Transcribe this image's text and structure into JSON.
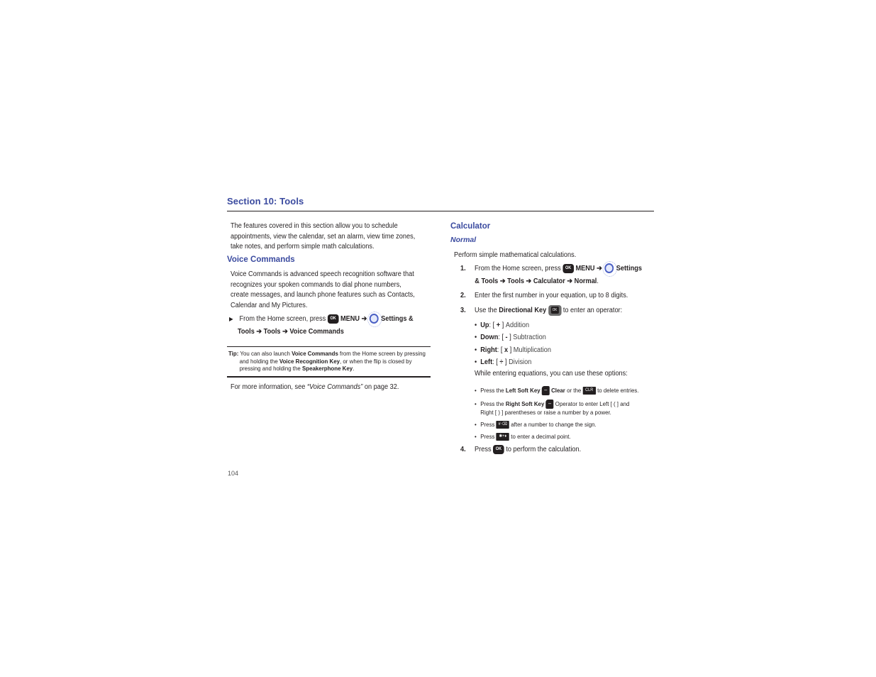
{
  "section_title": "Section 10: Tools",
  "intro": "The features covered in this section allow you to schedule appointments, view the calendar, set an alarm, view time zones, take notes, and perform simple math calculations.",
  "intro_lines": [
    "The features covered in this section allow you to schedule",
    "appointments, view the calendar, set an alarm, view time zones,",
    "take notes, and perform simple math calculations."
  ],
  "voice_commands": {
    "heading": "Voice Commands",
    "body_lines": [
      "Voice Commands is advanced speech recognition software that",
      "recognizes your spoken commands to dial phone numbers,",
      "create messages, and launch phone features such as Contacts,",
      "Calendar and My Pictures."
    ],
    "step": {
      "bullet": "▶",
      "prefix": "From the Home screen, press",
      "ok_key": "OK",
      "menu": "MENU",
      "arrow": "➔",
      "settings_line1": "Settings &",
      "settings_line2": "Tools",
      "tools": "Tools",
      "target": "Voice Commands"
    },
    "tip": {
      "label": "Tip:",
      "t1": "You can also launch",
      "b1": "Voice Commands",
      "t2": "from the Home screen by pressing",
      "t3": "and holding the",
      "b2": "Voice Recognition Key",
      "t4": ", or when the flip is closed by",
      "t5": "pressing and holding the",
      "b3": "Speakerphone Key",
      "t6": "."
    },
    "more_info": {
      "prefix": "For more information, see",
      "link": "“Voice Commands”",
      "suffix": "on page 32."
    }
  },
  "calculator": {
    "heading": "Calculator",
    "subheading": "Normal",
    "desc": "Perform simple mathematical calculations.",
    "steps": [
      {
        "num": "1.",
        "prefix": "From the Home screen, press",
        "ok_key": "OK",
        "menu": "MENU",
        "arrow": "➔",
        "settings": "Settings",
        "line2_a": "& Tools",
        "tools": "Tools",
        "calculator": "Calculator",
        "normal": "Normal",
        "period": "."
      },
      {
        "num": "2.",
        "text": "Enter the first number in your equation, up to 8 digits."
      },
      {
        "num": "3.",
        "prefix": "Use the",
        "bold": "Directional Key",
        "key": "OK",
        "suffix": "to enter an operator:"
      },
      {
        "num": "4.",
        "prefix": "Press",
        "key": "OK",
        "suffix": "to perform the calculation."
      }
    ],
    "operators": [
      {
        "dir": "Up",
        "sym": "+",
        "name": "Addition"
      },
      {
        "dir": "Down",
        "sym": "-",
        "name": "Subtraction"
      },
      {
        "dir": "Right",
        "sym": "x",
        "name": "Multiplication"
      },
      {
        "dir": "Left",
        "sym": "÷",
        "name": "Division"
      }
    ],
    "options_intro": "While entering equations, you can use these options:",
    "options": {
      "o1": {
        "t1": "Press the",
        "b1": "Left Soft Key",
        "key": "–",
        "b2": "Clear",
        "t2": "or the",
        "clr": "CLR",
        "t3": "to delete entries."
      },
      "o2": {
        "t1": "Press the",
        "b1": "Right Soft Key",
        "key": "–",
        "t2": "Operator to enter Left [ ( ] and",
        "t3": "Right [ ) ] parentheses or raise a number by a power."
      },
      "o3": {
        "t1": "Press",
        "key": "# ⌫",
        "t2": "after a number to change the sign."
      },
      "o4": {
        "t1": "Press",
        "key": "✱+♦",
        "t2": "to enter a decimal point."
      }
    }
  },
  "page_number": "104",
  "colors": {
    "heading_blue": "#3a4a9f",
    "text": "#231f20"
  }
}
